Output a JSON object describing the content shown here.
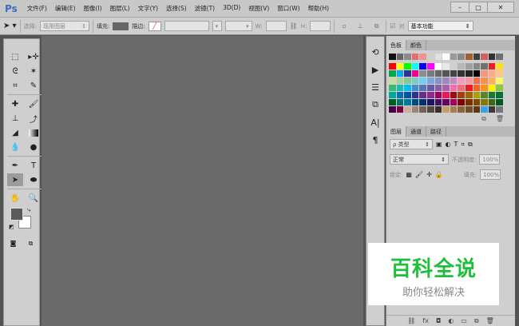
{
  "app": {
    "logo": "Ps"
  },
  "menu": [
    "文件(F)",
    "编辑(E)",
    "图像(I)",
    "图层(L)",
    "文字(Y)",
    "选择(S)",
    "滤镜(T)",
    "3D(D)",
    "视图(V)",
    "窗口(W)",
    "帮助(H)"
  ],
  "window_buttons": {
    "minimize": "–",
    "maximize": "□",
    "close": "✕"
  },
  "options": {
    "select_label": "选择:",
    "select_value": "现用图层",
    "fill_label": "填充:",
    "stroke_label": "描边:",
    "w_label": "W:",
    "h_label": "H:",
    "workspace": "基本功能",
    "check_label": "对"
  },
  "swatches": {
    "tabs": [
      "色板",
      "颜色"
    ],
    "recent": [
      "#111111",
      "#666666",
      "#8a8a8a",
      "#e07070",
      "#f09090",
      "#d0d0d0",
      "#e0e0e0",
      "#ffffff",
      "#9a9a9a",
      "#8a8a8a",
      "#a06030",
      "#404040",
      "#d06060",
      "#333333",
      "#707070"
    ],
    "grid": [
      "#ff0000",
      "#ffff00",
      "#00ff00",
      "#00ffff",
      "#0000ff",
      "#ff00ff",
      "#ffffff",
      "#e8e8e8",
      "#d0d0d0",
      "#b8b8b8",
      "#a0a0a0",
      "#888888",
      "#707070",
      "#ee1c24",
      "#ffde17",
      "#00a651",
      "#00aeef",
      "#2e3192",
      "#ec008c",
      "#8c8c8c",
      "#7a7a7a",
      "#666666",
      "#555555",
      "#444444",
      "#333333",
      "#222222",
      "#000000",
      "#f7977a",
      "#fbad82",
      "#fdc68a",
      "#c4df9b",
      "#a3d39c",
      "#82ca9c",
      "#7accc8",
      "#6dcff6",
      "#7da7d9",
      "#8393ca",
      "#a187be",
      "#bc8dbf",
      "#f49ac2",
      "#f6989d",
      "#f26c4f",
      "#f68e55",
      "#fbaf5c",
      "#fff467",
      "#3cb878",
      "#1cbbb4",
      "#00bff3",
      "#448ccb",
      "#5674b9",
      "#605ca8",
      "#855fa8",
      "#a763a8",
      "#f06eaa",
      "#f26d7d",
      "#ed1c24",
      "#f26522",
      "#f7941d",
      "#fff200",
      "#8dc63f",
      "#00a99d",
      "#0072bc",
      "#0054a6",
      "#2e3192",
      "#662d91",
      "#92278f",
      "#9e005d",
      "#ed145b",
      "#9e0b0f",
      "#a0410d",
      "#a36209",
      "#aba000",
      "#598527",
      "#197b30",
      "#007236",
      "#005e20",
      "#00746b",
      "#0076a3",
      "#004a80",
      "#003471",
      "#1b1464",
      "#440e62",
      "#630460",
      "#9e005d",
      "#790000",
      "#7b2e00",
      "#7d4900",
      "#827b00",
      "#406618",
      "#005826",
      "#4b0049",
      "#7b0046",
      "#c7b299",
      "#998675",
      "#736357",
      "#534741",
      "#37302d",
      "#c69c6d",
      "#a67c52",
      "#8c6239",
      "#754c24",
      "#603913",
      "#3aa0e8",
      "#3a3a3a",
      "#777777"
    ]
  },
  "layers": {
    "tabs": [
      "图层",
      "通道",
      "路径"
    ],
    "filter": "ρ 类型",
    "blend": "正常",
    "opacity_label": "不透明度:",
    "opacity": "100%",
    "lock_label": "锁定:",
    "fill_label": "填充:",
    "fill": "100%",
    "footer_icons": [
      "⛓",
      "fx",
      "◘",
      "◐",
      "▭",
      "⧉",
      "🗑"
    ]
  },
  "watermark": {
    "title": "百科全说",
    "subtitle": "助你轻松解决"
  }
}
